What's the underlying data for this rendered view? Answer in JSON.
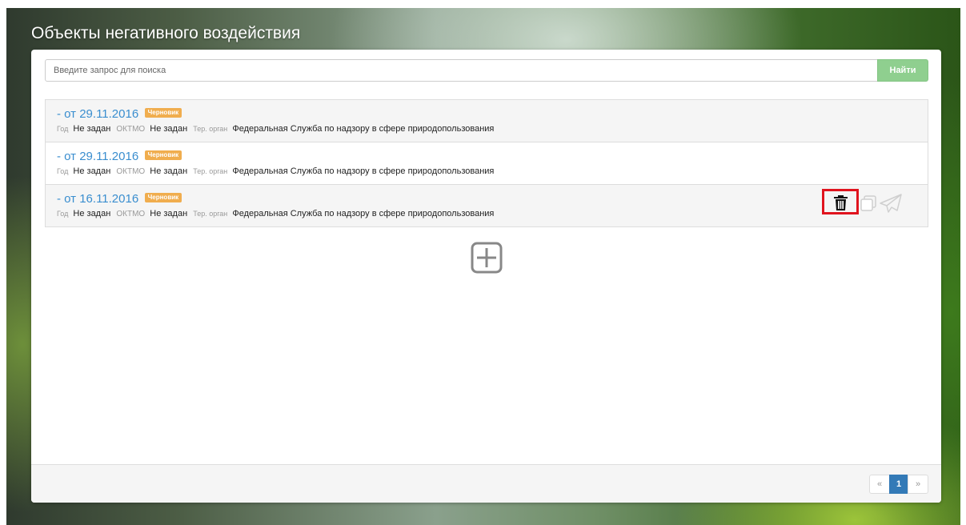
{
  "page": {
    "title": "Объекты негативного воздействия"
  },
  "search": {
    "placeholder": "Введите запрос для поиска",
    "button_label": "Найти"
  },
  "labels": {
    "year": "Год",
    "oktmo": "ОКТМО",
    "ter_organ": "Тер. орган"
  },
  "items": [
    {
      "title": "- от 29.11.2016",
      "status": "Черновик",
      "year": "Не задан",
      "oktmo": "Не задан",
      "ter_organ": "Федеральная Служба по надзору в сфере природопользования"
    },
    {
      "title": "- от 29.11.2016",
      "status": "Черновик",
      "year": "Не задан",
      "oktmo": "Не задан",
      "ter_organ": "Федеральная Служба по надзору в сфере природопользования"
    },
    {
      "title": "- от 16.11.2016",
      "status": "Черновик",
      "year": "Не задан",
      "oktmo": "Не задан",
      "ter_organ": "Федеральная Служба по надзору в сфере природопользования"
    }
  ],
  "icons": {
    "delete": "trash-icon",
    "copy": "copy-icon",
    "send": "paper-plane-icon",
    "add": "plus-square-icon"
  },
  "pagination": {
    "prev": "«",
    "current": "1",
    "next": "»"
  },
  "colors": {
    "link": "#3a8ecf",
    "badge": "#f0ad4e",
    "search_button": "#8fcf8f",
    "active_page": "#337ab7",
    "highlight_border": "#e0141e"
  }
}
